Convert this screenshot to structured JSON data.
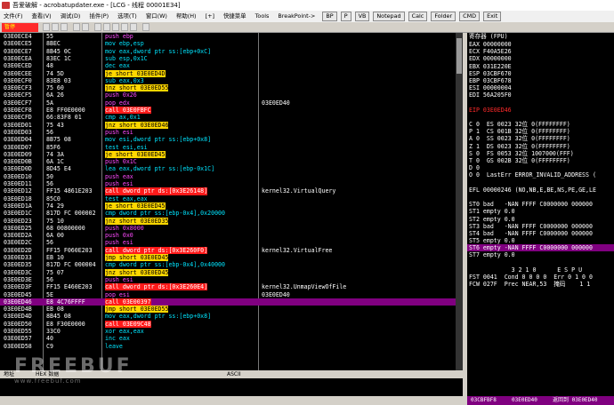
{
  "window": {
    "title": "吾爱破解 - acrobatupdater.exe - [LCG - 线程 00001E34]"
  },
  "menu": {
    "items": [
      "文件(F)",
      "查看(V)",
      "调试(D)",
      "插件(P)",
      "选项(T)",
      "窗口(W)",
      "帮助(H)",
      "[+]",
      "快捷菜单",
      "Tools",
      "BreakPoint->"
    ],
    "tool_buttons": [
      "BP",
      "P",
      "VB",
      "Notepad",
      "Calc",
      "Folder",
      "CMD",
      "Exit"
    ]
  },
  "toolbar": {
    "status_label": "暂停"
  },
  "colors": {
    "background": "#000000",
    "selected_row": "#800080",
    "jump_highlight": "#ffd700",
    "call_highlight": "#ff1a1a"
  },
  "disasm": {
    "rows": [
      {
        "addr": "03E0ECE4",
        "hex": "55",
        "dis": "push ebp",
        "cmt": ""
      },
      {
        "addr": "03E0ECE5",
        "hex": "8BEC",
        "dis": "mov ebp,esp",
        "cmt": ""
      },
      {
        "addr": "03E0ECE7",
        "hex": "8B45 0C",
        "dis": "mov eax,dword ptr ss:[ebp+0xC]",
        "cmt": ""
      },
      {
        "addr": "03E0ECEA",
        "hex": "83EC 1C",
        "dis": "sub esp,0x1C",
        "cmt": ""
      },
      {
        "addr": "03E0ECED",
        "hex": "48",
        "dis": "dec eax",
        "cmt": ""
      },
      {
        "addr": "03E0ECEE",
        "hex": "74 5D",
        "dis": "je short 03E0ED4D",
        "cmt": ""
      },
      {
        "addr": "03E0ECF0",
        "hex": "83E8 03",
        "dis": "sub eax,0x3",
        "cmt": ""
      },
      {
        "addr": "03E0ECF3",
        "hex": "75 60",
        "dis": "jnz short 03E0ED55",
        "cmt": ""
      },
      {
        "addr": "03E0ECF5",
        "hex": "6A 26",
        "dis": "push 0x26",
        "cmt": ""
      },
      {
        "addr": "03E0ECF7",
        "hex": "5A",
        "dis": "pop edx",
        "cmt": "03E0ED40"
      },
      {
        "addr": "03E0ECF8",
        "hex": "E8 FF0E0000",
        "dis": "call 03E0FBFC",
        "cmt": ""
      },
      {
        "addr": "03E0ECFD",
        "hex": "66:83F8 01",
        "dis": "cmp ax,0x1",
        "cmt": ""
      },
      {
        "addr": "03E0ED01",
        "hex": "75 43",
        "dis": "jnz short 03E0ED46",
        "cmt": ""
      },
      {
        "addr": "03E0ED03",
        "hex": "56",
        "dis": "push esi",
        "cmt": ""
      },
      {
        "addr": "03E0ED04",
        "hex": "8B75 08",
        "dis": "mov esi,dword ptr ss:[ebp+0x8]",
        "cmt": ""
      },
      {
        "addr": "03E0ED07",
        "hex": "85F6",
        "dis": "test esi,esi",
        "cmt": ""
      },
      {
        "addr": "03E0ED09",
        "hex": "74 3A",
        "dis": "je short 03E0ED45",
        "cmt": ""
      },
      {
        "addr": "03E0ED0B",
        "hex": "6A 1C",
        "dis": "push 0x1C",
        "cmt": ""
      },
      {
        "addr": "03E0ED0D",
        "hex": "8D45 E4",
        "dis": "lea eax,dword ptr ss:[ebp-0x1C]",
        "cmt": ""
      },
      {
        "addr": "03E0ED10",
        "hex": "50",
        "dis": "push eax",
        "cmt": ""
      },
      {
        "addr": "03E0ED11",
        "hex": "56",
        "dis": "push esi",
        "cmt": ""
      },
      {
        "addr": "03E0ED12",
        "hex": "FF15 4861E203",
        "dis": "call dword ptr ds:[0x3E26148]",
        "cmt": "kernel32.VirtualQuery"
      },
      {
        "addr": "03E0ED18",
        "hex": "85C0",
        "dis": "test eax,eax",
        "cmt": ""
      },
      {
        "addr": "03E0ED1A",
        "hex": "74 29",
        "dis": "je short 03E0ED45",
        "cmt": ""
      },
      {
        "addr": "03E0ED1C",
        "hex": "817D FC 000002",
        "dis": "cmp dword ptr ss:[ebp-0x4],0x20000",
        "cmt": ""
      },
      {
        "addr": "03E0ED23",
        "hex": "75 10",
        "dis": "jnz short 03E0ED35",
        "cmt": ""
      },
      {
        "addr": "03E0ED25",
        "hex": "68 00800000",
        "dis": "push 0x8000",
        "cmt": ""
      },
      {
        "addr": "03E0ED2A",
        "hex": "6A 00",
        "dis": "push 0x0",
        "cmt": ""
      },
      {
        "addr": "03E0ED2C",
        "hex": "56",
        "dis": "push esi",
        "cmt": ""
      },
      {
        "addr": "03E0ED2D",
        "hex": "FF15 F060E203",
        "dis": "call dword ptr ds:[0x3E260F0]",
        "cmt": "kernel32.VirtualFree"
      },
      {
        "addr": "03E0ED33",
        "hex": "EB 10",
        "dis": "jmp short 03E0ED45",
        "cmt": ""
      },
      {
        "addr": "03E0ED35",
        "hex": "817D FC 000004",
        "dis": "cmp dword ptr ss:[ebp-0x4],0x40000",
        "cmt": ""
      },
      {
        "addr": "03E0ED3C",
        "hex": "75 07",
        "dis": "jnz short 03E0ED45",
        "cmt": ""
      },
      {
        "addr": "03E0ED3E",
        "hex": "56",
        "dis": "push esi",
        "cmt": ""
      },
      {
        "addr": "03E0ED3F",
        "hex": "FF15 E460E203",
        "dis": "call dword ptr ds:[0x3E260E4]",
        "cmt": "kernel32.UnmapViewOfFile"
      },
      {
        "addr": "03E0ED45",
        "hex": "5E",
        "dis": "pop esi",
        "cmt": "03E0ED40"
      },
      {
        "addr": "03E0ED46",
        "hex": "E8 4C76FFFF",
        "dis": "call 03E00397",
        "cmt": ""
      },
      {
        "addr": "03E0ED4B",
        "hex": "EB 08",
        "dis": "jmp short 03E0ED55",
        "cmt": ""
      },
      {
        "addr": "03E0ED4D",
        "hex": "8B45 08",
        "dis": "mov eax,dword ptr ss:[ebp+0x8]",
        "cmt": ""
      },
      {
        "addr": "03E0ED50",
        "hex": "E8 F30E0000",
        "dis": "call 03E09C48",
        "cmt": ""
      },
      {
        "addr": "03E0ED55",
        "hex": "33C0",
        "dis": "xor eax,eax",
        "cmt": ""
      },
      {
        "addr": "03E0ED57",
        "hex": "40",
        "dis": "inc eax",
        "cmt": ""
      },
      {
        "addr": "03E0ED58",
        "hex": "C9",
        "dis": "leave",
        "cmt": ""
      }
    ]
  },
  "registers": {
    "title": "寄存器 (FPU)",
    "lines": [
      "EAX 00000000",
      "ECX F40A5E26",
      "EDX 00000000",
      "EBX 031E220E",
      "ESP 03CBF670",
      "EBP 03CBF678",
      "ESI 00000004",
      "EDI 56A205F0",
      "",
      "EIP 03E0ED46",
      "",
      "C 0  ES 0023 32位 0(FFFFFFFF)",
      "P 1  CS 001B 32位 0(FFFFFFFF)",
      "A 0  SS 0023 32位 0(FFFFFFFF)",
      "Z 1  DS 0023 32位 0(FFFFFFFF)",
      "S 0  FS 0053 32位 1007000(FFF)",
      "T 0  GS 002B 32位 0(FFFFFFFF)",
      "D 0",
      "O 0  LastErr ERROR_INVALID_ADDRESS (",
      "",
      "EFL 00000246 (NO,NB,E,BE,NS,PE,GE,LE",
      "",
      "ST0 bad   -NAN FFFF C0000000 000000",
      "ST1 empty 0.0",
      "ST2 empty 0.0",
      "ST3 bad   -NAN FFFF C0000000 000000",
      "ST4 bad   -NAN FFFF C0000000 000000",
      "ST5 empty 0.0",
      "ST6 empty -NAN FFFF C0000000 000000",
      "ST7 empty 0.0",
      "",
      "            3 2 1 0      E S P U",
      "FST 0041  Cond 0 0 0 0  Err 0 1 0 0",
      "FCW 027F  Prec NEAR,53  掩码    1 1"
    ]
  },
  "bottom_pane": {
    "tabs": [
      "地址",
      "HEX 数据",
      "ASCII"
    ]
  },
  "status_bar": {
    "left": "03CBFBF8",
    "mid": "03E0ED40",
    "right": "返回到 03E0ED40"
  },
  "watermark": {
    "text": "FREEBUF",
    "subtext": "www.freebuf.com"
  }
}
